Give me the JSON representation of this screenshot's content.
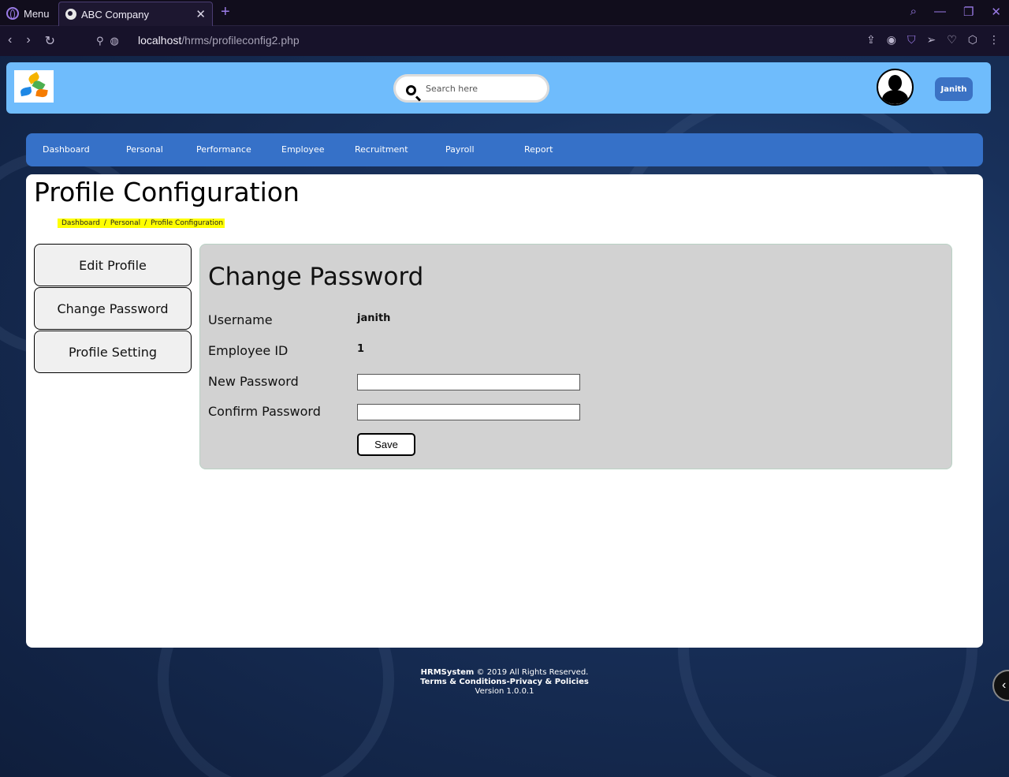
{
  "browser": {
    "menu_label": "Menu",
    "tab_title": "ABC Company",
    "url_host": "localhost",
    "url_path": "/hrms/profileconfig2.php"
  },
  "header": {
    "search_placeholder": "Search here",
    "user_button": "Janith"
  },
  "nav": {
    "items": [
      "Dashboard",
      "Personal",
      "Performance",
      "Employee",
      "Recruitment",
      "Payroll",
      "Report"
    ]
  },
  "page": {
    "title": "Profile Configuration",
    "breadcrumb": [
      "Dashboard",
      "/",
      "Personal",
      "/",
      "Profile Configuration"
    ]
  },
  "sidebar": {
    "buttons": [
      "Edit Profile",
      "Change Password",
      "Profile Setting"
    ]
  },
  "form": {
    "title": "Change Password",
    "username_label": "Username",
    "username_value": "janith",
    "empid_label": "Employee ID",
    "empid_value": "1",
    "new_password_label": "New Password",
    "confirm_password_label": "Confirm Password",
    "save_label": "Save"
  },
  "footer": {
    "brand": "HRMSystem",
    "copyright": "© 2019 All Rights Reserved.",
    "links": "Terms & Conditions-Privacy & Policies",
    "version": "Version 1.0.0.1"
  }
}
